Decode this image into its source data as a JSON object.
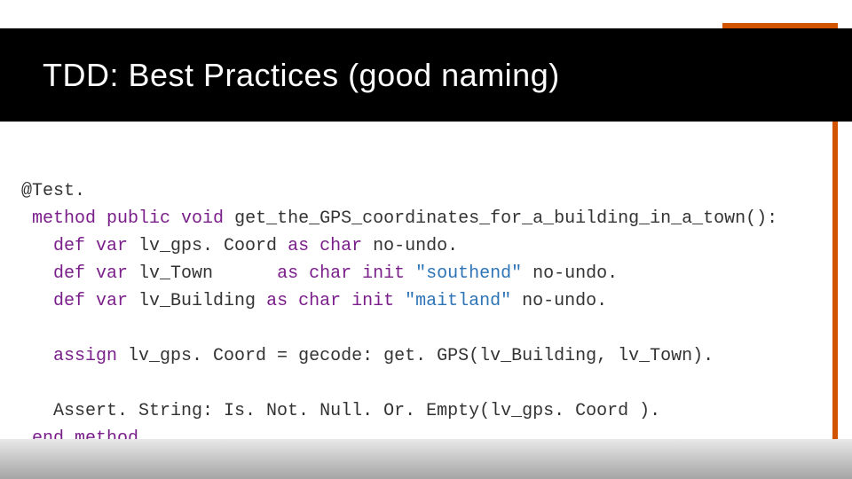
{
  "title": "TDD: Best Practices (good naming)",
  "code": {
    "l1": "@Test.",
    "l2a": "method public void",
    "l2b": " get_the_GPS_coordinates_for_a_building_in_a_town():",
    "l3a": "def var",
    "l3b": " lv_gps. Coord ",
    "l3c": "as char",
    "l3d": " no-undo.",
    "l4a": "def var",
    "l4b": " lv_Town      ",
    "l4c": "as char init",
    "l4d": " \"southend\" ",
    "l4e": "no-undo.",
    "l5a": "def var",
    "l5b": " lv_Building ",
    "l5c": "as char init",
    "l5d": " \"maitland\" ",
    "l5e": "no-undo.",
    "l6a": "assign",
    "l6b": " lv_gps. Coord = gecode: get. GPS(lv_Building, lv_Town).",
    "l7": "Assert. String: Is. Not. Null. Or. Empty(lv_gps. Coord ).",
    "l8": "end method."
  },
  "colors": {
    "accent": "#d35400",
    "bg_header": "#000000",
    "keyword": "#7a1f8a",
    "string": "#2e74b5"
  }
}
